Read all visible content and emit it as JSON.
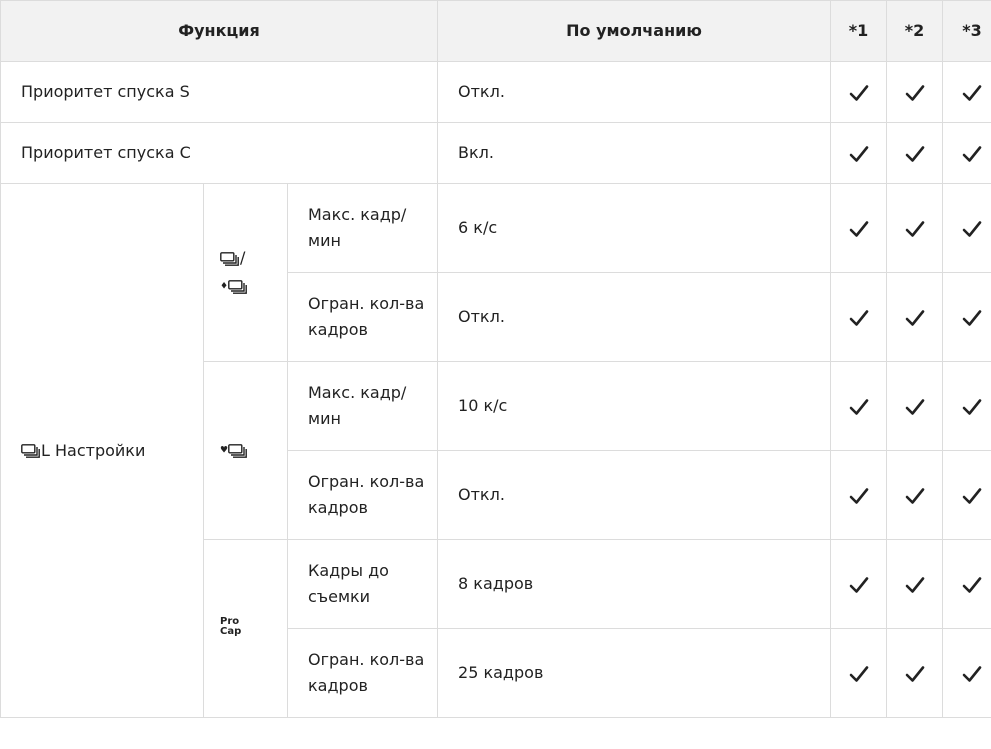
{
  "header": {
    "function": "Функция",
    "default": "По умолчанию",
    "c1": "*1",
    "c2": "*2",
    "c3": "*3"
  },
  "rows": {
    "shutter_s": {
      "label": "Приоритет спуска S",
      "default": "Откл."
    },
    "shutter_c": {
      "label": "Приоритет спуска C",
      "default": "Вкл."
    }
  },
  "group": {
    "label": "L Настройки",
    "mode_a_slash": "/",
    "procap_top": "Pro",
    "procap_bottom": "Cap",
    "subrows": [
      {
        "label": "Макс. кадр/мин",
        "default": "6 к/с"
      },
      {
        "label": "Огран. кол-ва кадров",
        "default": "Откл."
      },
      {
        "label": "Макс. кадр/мин",
        "default": "10 к/с"
      },
      {
        "label": "Огран. кол-ва кадров",
        "default": "Откл."
      },
      {
        "label": "Кадры до съемки",
        "default": "8 кадров"
      },
      {
        "label": "Огран. кол-ва кадров",
        "default": "25 кадров"
      }
    ]
  },
  "icons": {
    "check": "check-icon",
    "burst": "sequential-shooting-icon",
    "silent": "silent-diamond-icon",
    "heart": "heart-icon"
  }
}
